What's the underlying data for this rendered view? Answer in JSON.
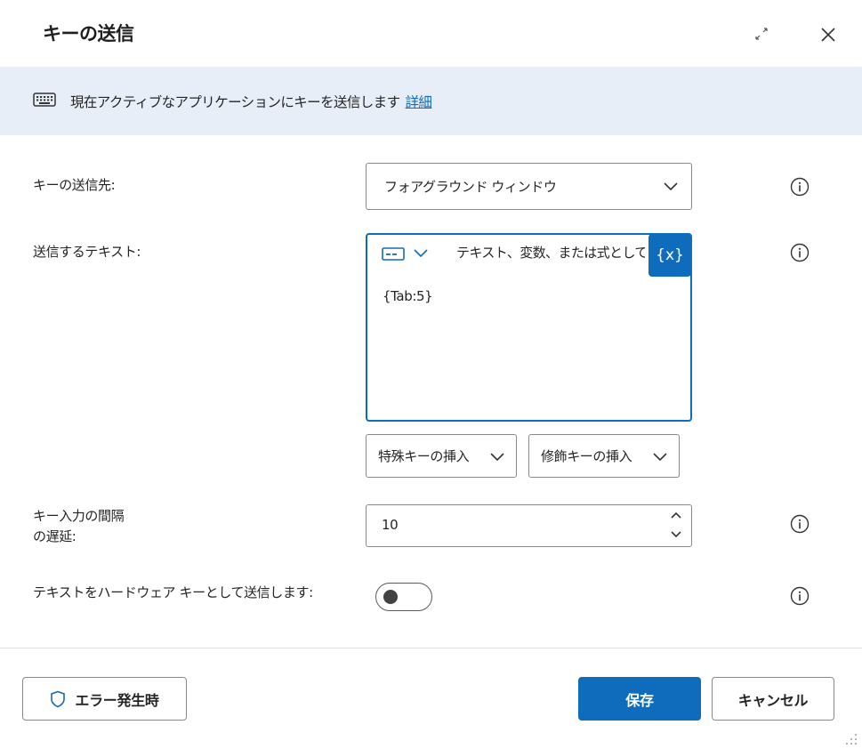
{
  "dialog": {
    "title": "キーの送信",
    "expand_icon": "expand-icon",
    "close_icon": "close-icon"
  },
  "banner": {
    "icon": "keyboard-icon",
    "text": "現在アクティブなアプリケーションにキーを送信します",
    "link": "詳細"
  },
  "fields": {
    "target": {
      "label": "キーの送信先:",
      "value": "フォアグラウンド ウィンドウ"
    },
    "text": {
      "label": "送信するテキスト:",
      "placeholder": "テキスト、変数、または式として",
      "value": "{Tab:5}",
      "variable_button": "{x}"
    },
    "special_key": "特殊キーの挿入",
    "modifier_key": "修飾キーの挿入",
    "delay": {
      "label_line1": "キー入力の間隔",
      "label_line2": "の遅延:",
      "value": "10"
    },
    "hardware": {
      "label": "テキストをハードウェア キーとして送信します:",
      "toggle_on": false
    }
  },
  "footer": {
    "on_error": "エラー発生時",
    "save": "保存",
    "cancel": "キャンセル"
  },
  "colors": {
    "accent": "#0f6cbd",
    "banner_bg": "#e7eef7"
  }
}
